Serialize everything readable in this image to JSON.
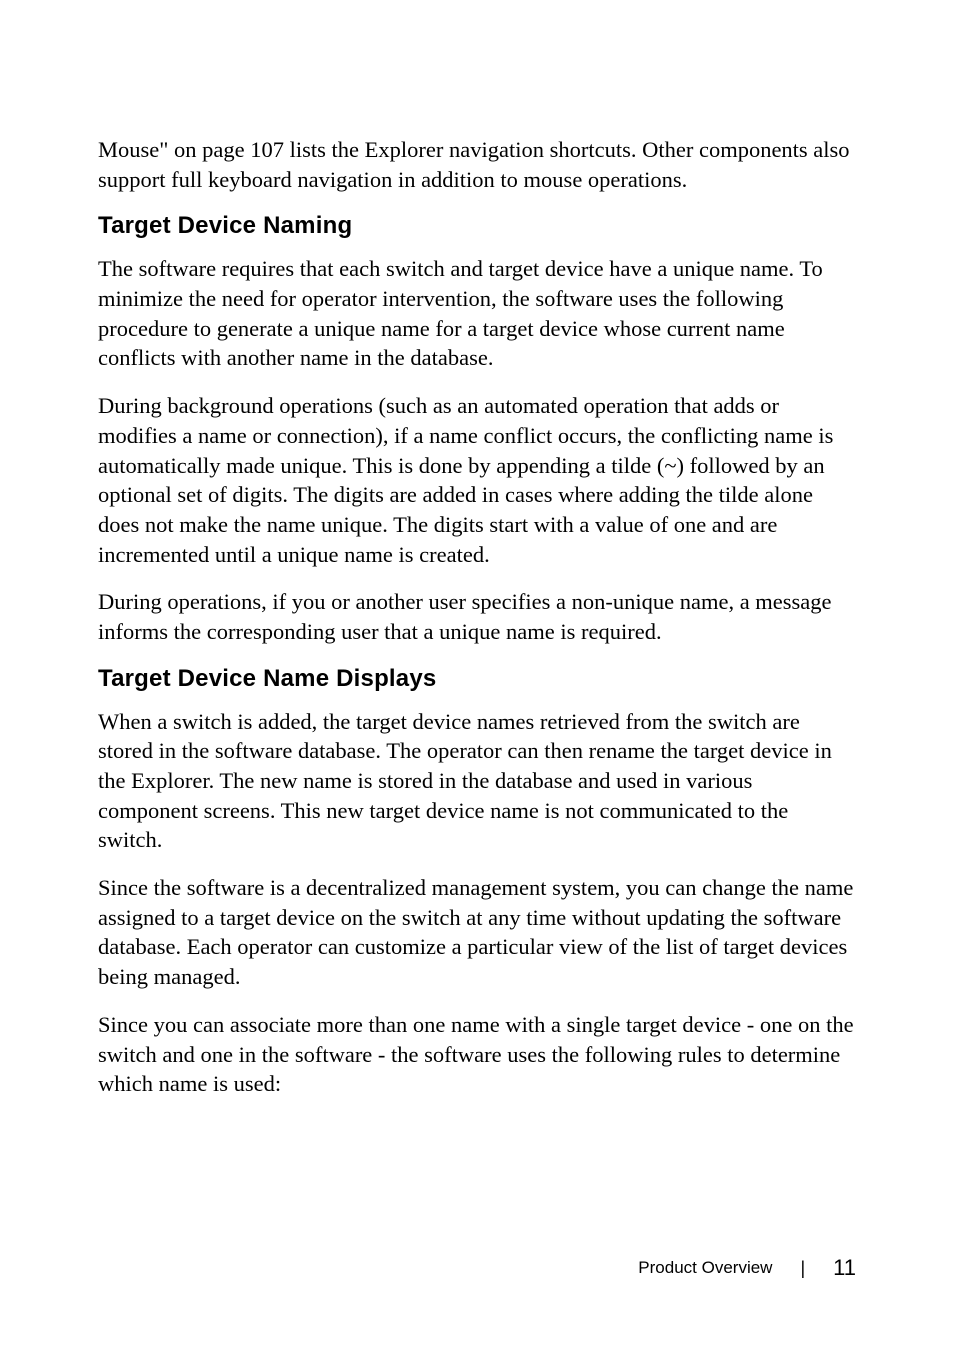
{
  "intro": "Mouse\" on page 107 lists the Explorer navigation shortcuts. Other components also support full keyboard navigation in addition to mouse operations.",
  "section1": {
    "heading": "Target Device Naming",
    "p1": "The software requires that each switch and target device have a unique name. To minimize the need for operator intervention, the software uses the following procedure to generate a unique name for a target device whose current name conflicts with another name in the database.",
    "p2": "During background operations (such as an automated operation that adds or modifies a name or connection), if a name conflict occurs, the conflicting name is automatically made unique. This is done by appending a tilde (~) followed by an optional set of digits. The digits are added in cases where adding the tilde alone does not make the name unique. The digits start with a value of one and are incremented until a unique name is created.",
    "p3": "During operations, if you or another user specifies a non-unique name, a message informs the corresponding user that a unique name is required."
  },
  "section2": {
    "heading": "Target Device Name Displays",
    "p1": "When a switch is added, the target device names retrieved from the switch are stored in the software database. The operator can then rename the target device in the Explorer. The new name is stored in the database and used in various component screens. This new target device name is not communicated to the switch.",
    "p2": "Since the software is a decentralized management system, you can change the name assigned to a target device on the switch at any time without updating the software database. Each operator can customize a particular view of the list of target devices being managed.",
    "p3": "Since you can associate more than one name with a single target device - one on the switch and one in the software - the software uses the following rules to determine which name is used:"
  },
  "footer": {
    "label": "Product Overview",
    "separator": "|",
    "page": "11"
  }
}
